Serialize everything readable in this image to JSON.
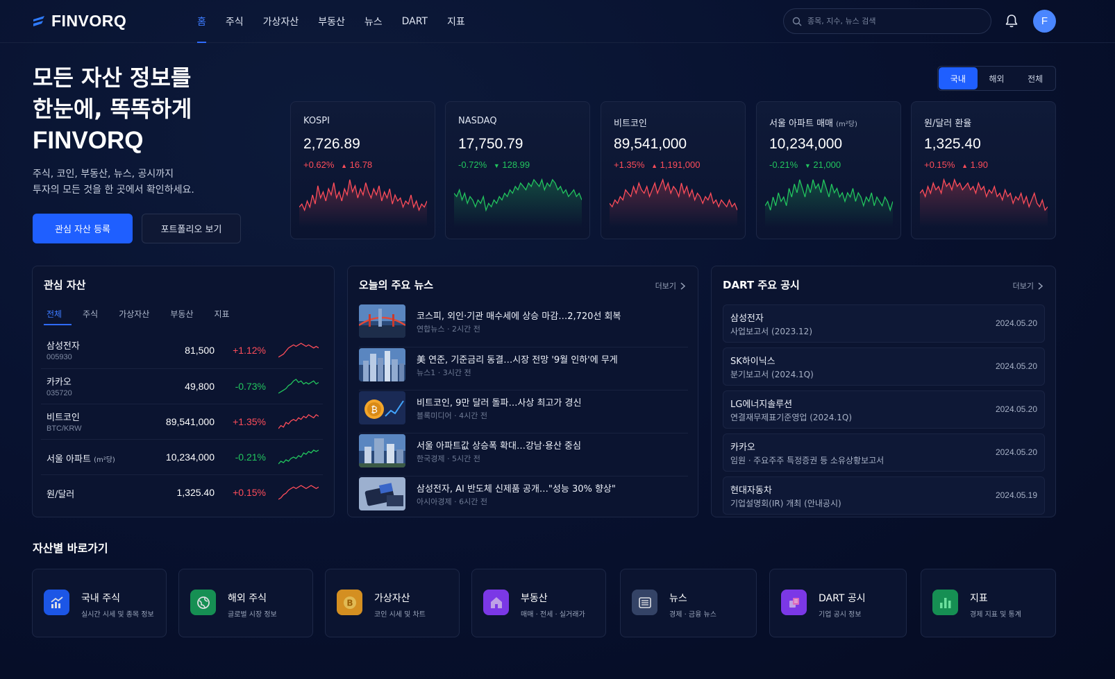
{
  "brand": "FINVORQ",
  "nav": {
    "items": [
      "홈",
      "주식",
      "가상자산",
      "부동산",
      "뉴스",
      "DART",
      "지표"
    ],
    "active_index": 0
  },
  "search": {
    "placeholder": "종목, 지수, 뉴스 검색"
  },
  "user": {
    "initial": "F"
  },
  "hero": {
    "title_line1": "모든 자산 정보를",
    "title_line2": "한눈에, 똑똑하게",
    "title_line3": "FINVORQ",
    "subtitle_line1": "주식, 코인, 부동산, 뉴스, 공시까지",
    "subtitle_line2": "투자의 모든 것을 한 곳에서 확인하세요.",
    "primary_button": "관심 자산 등록",
    "secondary_button": "포트폴리오 보기"
  },
  "region_tabs": {
    "items": [
      "국내",
      "해외",
      "전체"
    ],
    "active_index": 0
  },
  "market_cards": [
    {
      "label": "KOSPI",
      "unit": "",
      "value": "2,726.89",
      "change_pct": "+0.62%",
      "change_abs": "16.78",
      "direction": "up",
      "spark": [
        5,
        6,
        4,
        7,
        5,
        9,
        6,
        12,
        8,
        10,
        7,
        11,
        9,
        13,
        8,
        10,
        7,
        11,
        9,
        14,
        10,
        12,
        8,
        11,
        9,
        13,
        10,
        8,
        11,
        9,
        12,
        7,
        10,
        8,
        11,
        6,
        9,
        7,
        8,
        5,
        7,
        6,
        9,
        5,
        7,
        4,
        6,
        5,
        7
      ]
    },
    {
      "label": "NASDAQ",
      "unit": "",
      "value": "17,750.79",
      "change_pct": "-0.72%",
      "change_abs": "128.99",
      "direction": "down",
      "spark": [
        8,
        7,
        9,
        6,
        8,
        5,
        7,
        6,
        4,
        6,
        5,
        7,
        3,
        5,
        4,
        6,
        5,
        7,
        6,
        8,
        7,
        9,
        8,
        10,
        9,
        11,
        10,
        9,
        11,
        10,
        12,
        11,
        10,
        12,
        9,
        11,
        10,
        12,
        11,
        9,
        10,
        8,
        9,
        7,
        8,
        9,
        7,
        8,
        6
      ]
    },
    {
      "label": "비트코인",
      "unit": "",
      "value": "89,541,000",
      "change_pct": "+1.35%",
      "change_abs": "1,191,000",
      "direction": "up",
      "spark": [
        6,
        5,
        7,
        6,
        8,
        7,
        10,
        9,
        8,
        11,
        9,
        12,
        10,
        9,
        11,
        8,
        10,
        12,
        9,
        11,
        13,
        10,
        12,
        9,
        11,
        10,
        8,
        12,
        9,
        11,
        8,
        10,
        7,
        9,
        8,
        6,
        8,
        7,
        9,
        6,
        7,
        5,
        7,
        6,
        5,
        7,
        5,
        6,
        4
      ]
    },
    {
      "label": "서울 아파트 매매",
      "unit": "(m²당)",
      "value": "10,234,000",
      "change_pct": "-0.21%",
      "change_abs": "21,000",
      "direction": "down",
      "spark": [
        7,
        8,
        6,
        9,
        7,
        10,
        8,
        9,
        7,
        11,
        9,
        12,
        10,
        13,
        11,
        9,
        12,
        10,
        13,
        11,
        12,
        10,
        13,
        11,
        9,
        12,
        10,
        11,
        9,
        10,
        8,
        10,
        9,
        11,
        8,
        10,
        9,
        7,
        9,
        8,
        10,
        7,
        9,
        8,
        7,
        9,
        8,
        6,
        8
      ]
    },
    {
      "label": "원/달러 환율",
      "unit": "",
      "value": "1,325.40",
      "change_pct": "+0.15%",
      "change_abs": "1.90",
      "direction": "up",
      "spark": [
        9,
        10,
        8,
        11,
        9,
        12,
        10,
        11,
        9,
        13,
        11,
        12,
        10,
        13,
        11,
        12,
        10,
        11,
        12,
        10,
        11,
        9,
        12,
        10,
        11,
        8,
        10,
        9,
        11,
        8,
        9,
        7,
        10,
        8,
        9,
        6,
        8,
        7,
        9,
        6,
        8,
        5,
        7,
        9,
        6,
        5,
        7,
        4,
        5
      ]
    }
  ],
  "watchlist": {
    "title": "관심 자산",
    "tabs": [
      "전체",
      "주식",
      "가상자산",
      "부동산",
      "지표"
    ],
    "active_tab": 0,
    "rows": [
      {
        "name": "삼성전자",
        "unit": "",
        "code": "005930",
        "price": "81,500",
        "change": "+1.12%",
        "direction": "up",
        "spark": [
          3,
          4,
          5,
          7,
          9,
          10,
          11,
          10,
          11,
          12,
          11,
          10,
          11,
          10,
          9,
          10,
          9
        ]
      },
      {
        "name": "카카오",
        "unit": "",
        "code": "035720",
        "price": "49,800",
        "change": "-0.73%",
        "direction": "down",
        "spark": [
          3,
          4,
          5,
          6,
          8,
          9,
          11,
          12,
          10,
          11,
          9,
          10,
          9,
          10,
          11,
          9,
          10
        ]
      },
      {
        "name": "비트코인",
        "unit": "",
        "code": "BTC/KRW",
        "price": "89,541,000",
        "change": "+1.35%",
        "direction": "up",
        "spark": [
          3,
          5,
          4,
          7,
          6,
          8,
          9,
          8,
          10,
          9,
          11,
          10,
          12,
          11,
          10,
          12,
          11
        ]
      },
      {
        "name": "서울 아파트",
        "unit": "(m²당)",
        "code": "",
        "price": "10,234,000",
        "change": "-0.21%",
        "direction": "down",
        "spark": [
          2,
          4,
          3,
          5,
          4,
          6,
          7,
          6,
          8,
          7,
          10,
          9,
          11,
          10,
          12,
          11,
          12
        ]
      },
      {
        "name": "원/달러",
        "unit": "",
        "code": "",
        "price": "1,325.40",
        "change": "+0.15%",
        "direction": "up",
        "spark": [
          3,
          4,
          6,
          7,
          9,
          10,
          11,
          10,
          11,
          12,
          11,
          10,
          11,
          12,
          11,
          10,
          11
        ]
      }
    ]
  },
  "news": {
    "title": "오늘의 주요 뉴스",
    "more": "더보기",
    "items": [
      {
        "title": "코스피, 외인·기관 매수세에 상승 마감…2,720선 회복",
        "source": "연합뉴스",
        "time": "2시간 전",
        "thumb": "bridge"
      },
      {
        "title": "美 연준, 기준금리 동결…시장 전망 '9월 인하'에 무게",
        "source": "뉴스1",
        "time": "3시간 전",
        "thumb": "city"
      },
      {
        "title": "비트코인, 9만 달러 돌파…사상 최고가 경신",
        "source": "블록미디어",
        "time": "4시간 전",
        "thumb": "coin"
      },
      {
        "title": "서울 아파트값 상승폭 확대…강남·용산 중심",
        "source": "한국경제",
        "time": "5시간 전",
        "thumb": "apartment"
      },
      {
        "title": "삼성전자, AI 반도체 신제품 공개…\"성능 30% 향상\"",
        "source": "아시아경제",
        "time": "6시간 전",
        "thumb": "chip"
      }
    ]
  },
  "dart": {
    "title": "DART 주요 공시",
    "more": "더보기",
    "items": [
      {
        "company": "삼성전자",
        "report": "사업보고서 (2023.12)",
        "date": "2024.05.20"
      },
      {
        "company": "SK하이닉스",
        "report": "분기보고서 (2024.1Q)",
        "date": "2024.05.20"
      },
      {
        "company": "LG에너지솔루션",
        "report": "연결재무제표기준영업 (2024.1Q)",
        "date": "2024.05.20"
      },
      {
        "company": "카카오",
        "report": "임원ㆍ주요주주 특정증권 등 소유상황보고서",
        "date": "2024.05.20"
      },
      {
        "company": "현대자동차",
        "report": "기업설명회(IR) 개최 (안내공시)",
        "date": "2024.05.19"
      }
    ]
  },
  "shortcuts": {
    "title": "자산별 바로가기",
    "items": [
      {
        "name": "국내 주식",
        "desc": "실시간 시세 및 종목 정보",
        "icon": "chart-up-icon",
        "color": "#1f5fff"
      },
      {
        "name": "해외 주식",
        "desc": "글로벌 시장 정보",
        "icon": "globe-icon",
        "color": "#18a058"
      },
      {
        "name": "가상자산",
        "desc": "코인 시세 및 차트",
        "icon": "bitcoin-icon",
        "color": "#f0a020"
      },
      {
        "name": "부동산",
        "desc": "매매 · 전세 · 실거래가",
        "icon": "house-icon",
        "color": "#8b3dff"
      },
      {
        "name": "뉴스",
        "desc": "경제 · 금융 뉴스",
        "icon": "newspaper-icon",
        "color": "#3a4a6e"
      },
      {
        "name": "DART 공시",
        "desc": "기업 공시 정보",
        "icon": "document-icon",
        "color": "#8b3dff"
      },
      {
        "name": "지표",
        "desc": "경제 지표 및 통계",
        "icon": "bar-chart-icon",
        "color": "#18a058"
      }
    ]
  },
  "colors": {
    "accent": "#1f5fff",
    "up": "#ff4d5a",
    "down": "#22c55e"
  }
}
